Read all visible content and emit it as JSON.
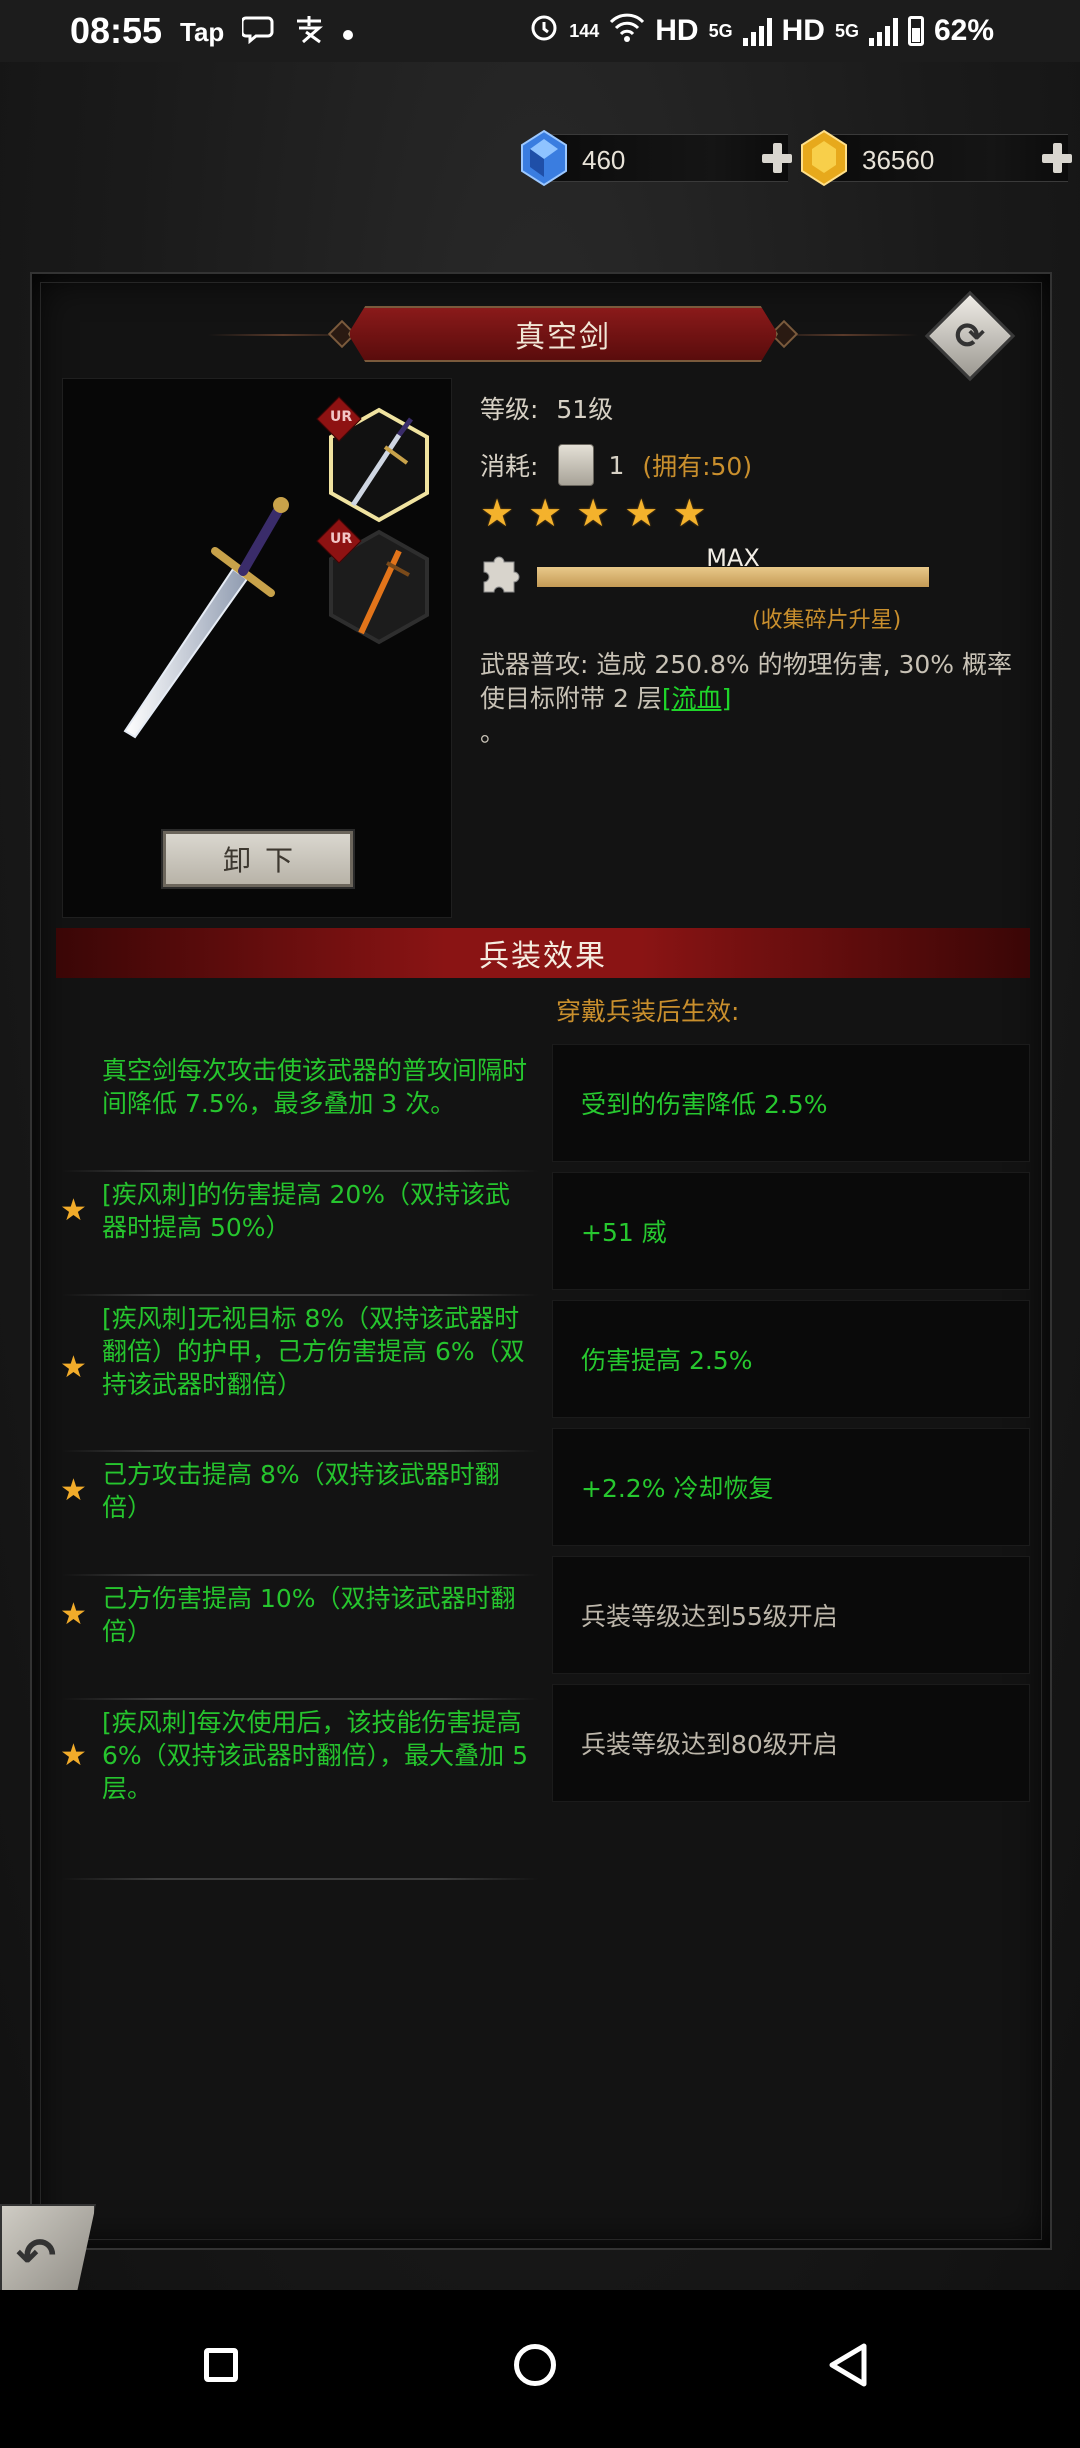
{
  "status_bar": {
    "time": "08:55",
    "left_icons": [
      "Tap",
      "chat-icon",
      "alipay-icon",
      "dot"
    ],
    "hd1": "HD",
    "net1": "5G",
    "hd2": "HD",
    "net2": "5G",
    "refresh": "144",
    "battery": "62%"
  },
  "currency": {
    "diamond": {
      "icon": "blue-gem-icon",
      "value": "460"
    },
    "gold": {
      "icon": "gold-gem-icon",
      "value": "36560"
    }
  },
  "weapon": {
    "name": "真空剑",
    "level_label": "等级:",
    "level_value": "51级",
    "cost_label": "消耗:",
    "cost_count": "1",
    "owned": "(拥有:50)",
    "stars": 5,
    "progress_label": "MAX",
    "progress_fraction": 1.0,
    "progress_hint": "(收集碎片升星)",
    "desc_main": "武器普攻: 造成 250.8% 的物理伤害, 30% 概率使目标附带 2 层",
    "desc_link": "[流血]",
    "desc_end": "。",
    "slot_badge": "UR",
    "unequip_label": "卸下"
  },
  "effects_section": {
    "title": "兵装效果",
    "subtitle": "穿戴兵装后生效:",
    "effects": [
      {
        "text": "真空剑每次攻击使该武器的普攻间隔时间降低 7.5%，最多叠加 3 次。",
        "star": false
      },
      {
        "text": "[疾风刺]的伤害提高 20%（双持该武器时提高 50%）",
        "star": true
      },
      {
        "text": "[疾风刺]无视目标 8%（双持该武器时翻倍）的护甲，己方伤害提高 6%（双持该武器时翻倍）",
        "star": true
      },
      {
        "text": "己方攻击提高 8%（双持该武器时翻倍）",
        "star": true
      },
      {
        "text": "己方伤害提高 10%（双持该武器时翻倍）",
        "star": true
      },
      {
        "text": "[疾风刺]每次使用后，该技能伤害提高 6%（双持该武器时翻倍），最大叠加 5 层。",
        "star": true
      }
    ],
    "bonuses": [
      {
        "text": "受到的伤害降低 2.5%",
        "state": "active"
      },
      {
        "text": "+51 威",
        "state": "active"
      },
      {
        "text": "伤害提高 2.5%",
        "state": "active"
      },
      {
        "text": "+2.2% 冷却恢复",
        "state": "active"
      },
      {
        "text": "兵装等级达到55级开启",
        "state": "locked"
      },
      {
        "text": "兵装等级达到80级开启",
        "state": "locked"
      }
    ]
  },
  "icons": {
    "swap": "swap-icon",
    "back": "back-arrow-icon",
    "puzzle": "puzzle-piece-icon",
    "scroll": "scroll-icon"
  },
  "colors": {
    "accent_red": "#8a1414",
    "gold_text": "#c98f2d",
    "green_text": "#26c52e",
    "star": "#f4b22c"
  }
}
